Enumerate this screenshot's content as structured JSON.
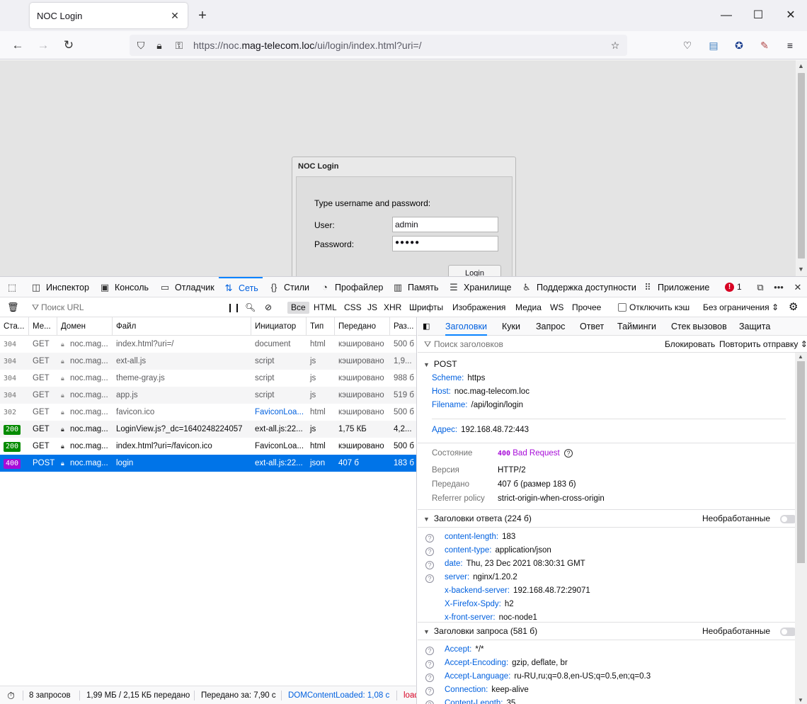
{
  "browser": {
    "tab_title": "NOC Login",
    "url_prefix": "https://noc.",
    "url_domain": "mag-telecom.loc",
    "url_path": "/ui/login/index.html?uri=/"
  },
  "login": {
    "title": "NOC Login",
    "prompt": "Type username and password:",
    "user_label": "User:",
    "user_value": "admin",
    "password_label": "Password:",
    "password_mask": "●●●●●",
    "button": "Login"
  },
  "devtools": {
    "tabs": [
      "Инспектор",
      "Консоль",
      "Отладчик",
      "Сеть",
      "Стили",
      "Профайлер",
      "Память",
      "Хранилище",
      "Поддержка доступности",
      "Приложение"
    ],
    "error_count": "1",
    "filter_placeholder": "Поиск URL",
    "type_filters": [
      "Все",
      "HTML",
      "CSS",
      "JS",
      "XHR",
      "Шрифты",
      "Изображения",
      "Медиа",
      "WS",
      "Прочее"
    ],
    "disable_cache": "Отключить кэш",
    "throttling": "Без ограничения ⇕",
    "columns": [
      "Ста...",
      "Ме...",
      "Домен",
      "Файл",
      "Инициатор",
      "Тип",
      "Передано",
      "Раз..."
    ],
    "requests": [
      {
        "status": "304",
        "method": "GET",
        "domain": "noc.mag...",
        "file": "index.html?uri=/",
        "initiator": "document",
        "type": "html",
        "transferred": "кэшировано",
        "size": "500 б"
      },
      {
        "status": "304",
        "method": "GET",
        "domain": "noc.mag...",
        "file": "ext-all.js",
        "initiator": "script",
        "type": "js",
        "transferred": "кэшировано",
        "size": "1,9..."
      },
      {
        "status": "304",
        "method": "GET",
        "domain": "noc.mag...",
        "file": "theme-gray.js",
        "initiator": "script",
        "type": "js",
        "transferred": "кэшировано",
        "size": "988 б"
      },
      {
        "status": "304",
        "method": "GET",
        "domain": "noc.mag...",
        "file": "app.js",
        "initiator": "script",
        "type": "js",
        "transferred": "кэшировано",
        "size": "519 б"
      },
      {
        "status": "302",
        "method": "GET",
        "domain": "noc.mag...",
        "file": "favicon.ico",
        "initiator": "FaviconLoa...",
        "type": "html",
        "transferred": "кэшировано",
        "size": "500 б"
      },
      {
        "status": "200",
        "method": "GET",
        "domain": "noc.mag...",
        "file": "LoginView.js?_dc=1640248224057",
        "initiator": "ext-all.js:22...",
        "type": "js",
        "transferred": "1,75 КБ",
        "size": "4,2..."
      },
      {
        "status": "200",
        "method": "GET",
        "domain": "noc.mag...",
        "file": "index.html?uri=/favicon.ico",
        "initiator": "FaviconLoa...",
        "type": "html",
        "transferred": "кэшировано",
        "size": "500 б"
      },
      {
        "status": "400",
        "method": "POST",
        "domain": "noc.mag...",
        "file": "login",
        "initiator": "ext-all.js:22...",
        "type": "json",
        "transferred": "407 б",
        "size": "183 б"
      }
    ],
    "detail_tabs": [
      "Заголовки",
      "Куки",
      "Запрос",
      "Ответ",
      "Тайминги",
      "Стек вызовов",
      "Защита"
    ],
    "detail_filter_placeholder": "Поиск заголовков",
    "block_button": "Блокировать",
    "resend_button": "Повторить отправку ⇕",
    "summary": {
      "method": "POST",
      "scheme_k": "Scheme:",
      "scheme_v": "https",
      "host_k": "Host:",
      "host_v": "noc.mag-telecom.loc",
      "filename_k": "Filename:",
      "filename_v": "/api/login/login",
      "address_k": "Адрес:",
      "address_v": "192.168.48.72:443",
      "state_k": "Состояние",
      "state_code": "400",
      "state_text": "Bad Request",
      "version_k": "Версия",
      "version_v": "HTTP/2",
      "transferred_k": "Передано",
      "transferred_v": "407 б (размер 183 б)",
      "referrer_k": "Referrer policy",
      "referrer_v": "strict-origin-when-cross-origin"
    },
    "response_headers_title": "Заголовки ответа (224 б)",
    "raw_label": "Необработанные",
    "response_headers": [
      {
        "k": "content-length:",
        "v": "183"
      },
      {
        "k": "content-type:",
        "v": "application/json"
      },
      {
        "k": "date:",
        "v": "Thu, 23 Dec 2021 08:30:31 GMT"
      },
      {
        "k": "server:",
        "v": "nginx/1.20.2"
      },
      {
        "k": "x-backend-server:",
        "v": "192.168.48.72:29071"
      },
      {
        "k": "X-Firefox-Spdy:",
        "v": "h2"
      },
      {
        "k": "x-front-server:",
        "v": "noc-node1"
      }
    ],
    "request_headers_title": "Заголовки запроса (581 б)",
    "request_headers": [
      {
        "k": "Accept:",
        "v": "*/*"
      },
      {
        "k": "Accept-Encoding:",
        "v": "gzip, deflate, br"
      },
      {
        "k": "Accept-Language:",
        "v": "ru-RU,ru;q=0.8,en-US;q=0.5,en;q=0.3"
      },
      {
        "k": "Connection:",
        "v": "keep-alive"
      },
      {
        "k": "Content-Length:",
        "v": "35"
      }
    ],
    "statusbar": {
      "requests": "8 запросов",
      "size": "1,99 МБ / 2,15 КБ передано",
      "finish": "Передано за: 7,90 с",
      "dcl": "DOMContentLoaded: 1,08 с",
      "load": "load"
    }
  }
}
